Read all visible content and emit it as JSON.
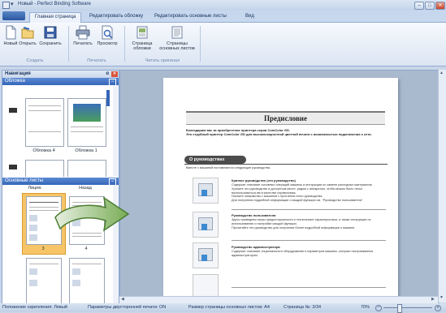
{
  "window": {
    "title": "Новый - Perfect Binding Software",
    "minimize": "–",
    "maximize": "□",
    "close": "✕"
  },
  "tabs": [
    {
      "label": "Главная страница"
    },
    {
      "label": "Редактировать обложку"
    },
    {
      "label": "Редактировать основные листы"
    },
    {
      "label": "Вид"
    }
  ],
  "ribbon": {
    "create": {
      "new": "Новый",
      "open": "Открыть",
      "save": "Сохранить",
      "group": "Создать"
    },
    "print": {
      "print": "Печатать",
      "preview": "Просмотр",
      "group": "Печатать"
    },
    "read": {
      "cover_page": "Страница\nобложки",
      "body_pages": "Страницы\nосновных листов",
      "group": "Читать оригинал"
    }
  },
  "nav": {
    "title": "Навигация",
    "pin": "ᵖ",
    "close": "✕",
    "cover": {
      "header": "Обложка",
      "toggle": "−",
      "thumbs": [
        {
          "caption": "Обложка 4"
        },
        {
          "caption": "Обложка 1"
        }
      ]
    },
    "body": {
      "header": "Основные листы",
      "toggle": "−",
      "col_left": "Лицев.",
      "col_right": "Назад",
      "thumbs": [
        {
          "caption": "3"
        },
        {
          "caption": "4"
        }
      ]
    }
  },
  "document": {
    "heading": "Предисловие",
    "intro": "Благодарим вас за приобретение принтера серии ComColor GD.\nЭто струйный принтер ComColor GD для высокоскоростной цветной печати с возможностью подключения к сети.",
    "section_title": "О руководствах",
    "section_intro": "Вместе с машиной поставляются следующие руководства.",
    "manuals": [
      {
        "title": "Краткое руководство (это руководство)",
        "text": "Содержит описание основных операций машины и инструкции по замене расходных материалов.\nХраните это руководство в доступном месте, рядом с аппаратом, чтобы можно было легко воспользоваться им в качестве справочника.\nНачните знакомство с машиной с прочтения этого руководства.\nДля получения подробной информации о каждой функции см. \"Руководство пользователя\"."
      },
      {
        "title": "Руководство пользователя",
        "text": "Здесь приведены меры предосторожности и технические характеристики, а также инструкции по использованию и настройке каждой функции.\nПрочитайте это руководство для получения более подробной информации о машине."
      },
      {
        "title": "Руководство администратора",
        "text": "Содержит описание опционального оборудования и параметров машины, которые настраиваются администратором."
      }
    ]
  },
  "status": {
    "binding": "Положение скрепления: Левый",
    "duplex": "Параметры двусторонней печати: ON",
    "pagesize": "Размер страницы основных листов: A4",
    "pageno": "Страница №: 3/34",
    "zoom": "70%",
    "zoom_level_percent": 70
  },
  "colors": {
    "accent": "#3566b8",
    "selection": "#f7c567",
    "arrow": "#5c9a3e"
  }
}
